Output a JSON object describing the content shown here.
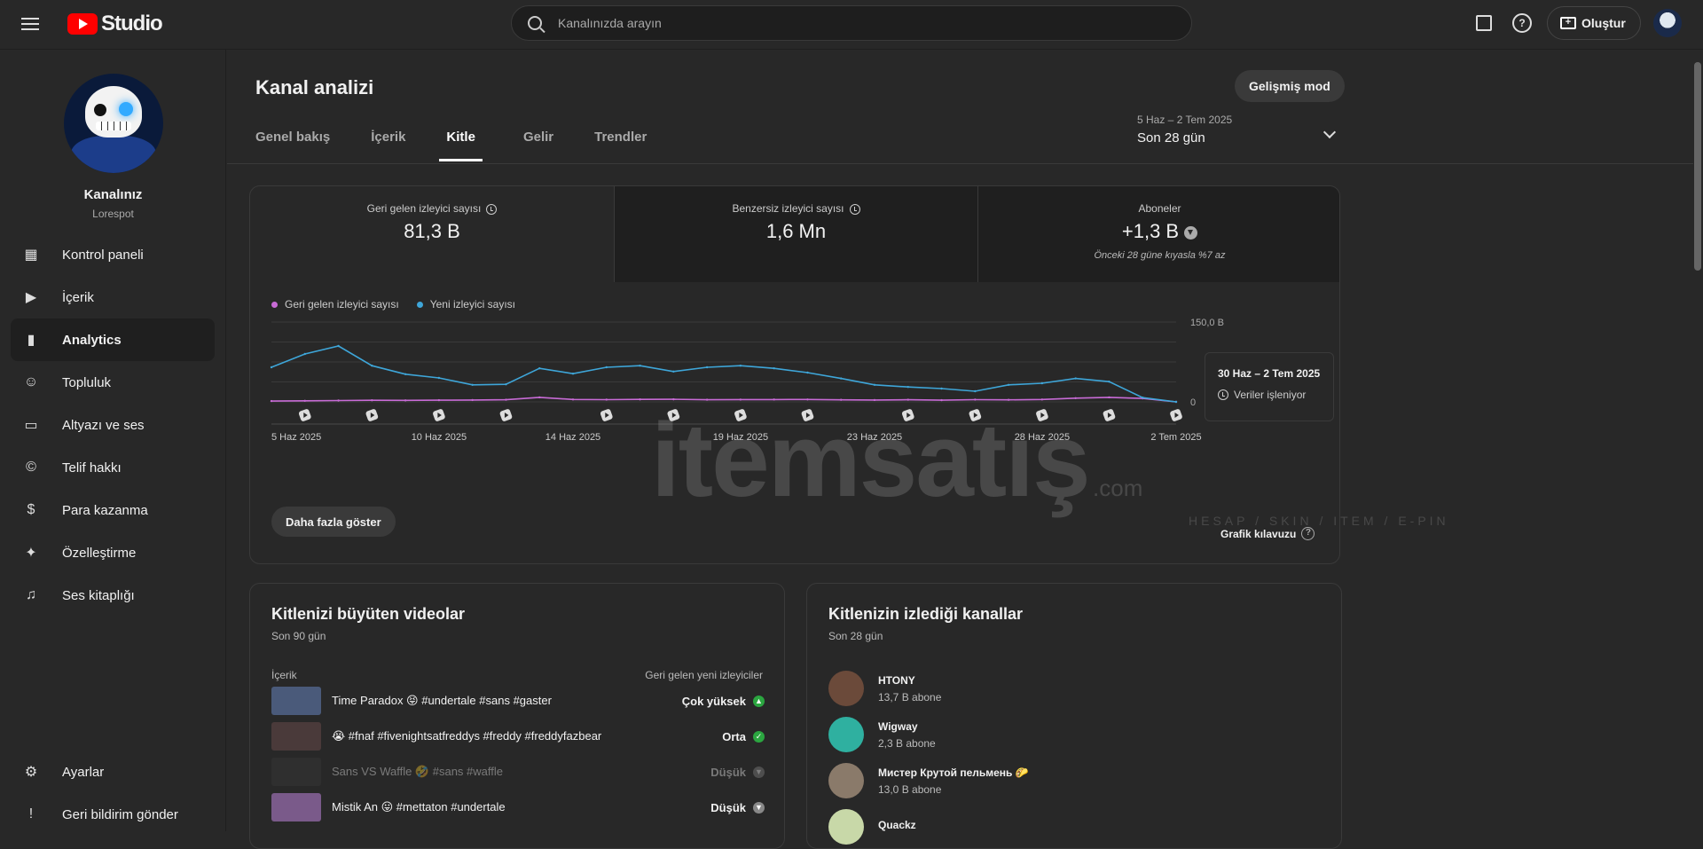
{
  "header": {
    "logo_text": "Studio",
    "search_placeholder": "Kanalınızda arayın",
    "create_label": "Oluştur"
  },
  "sidebar": {
    "channel_name": "Kanalınız",
    "channel_handle": "Lorespot",
    "items": [
      {
        "label": "Kontrol paneli",
        "icon": "dashboard-icon"
      },
      {
        "label": "İçerik",
        "icon": "content-icon"
      },
      {
        "label": "Analytics",
        "icon": "analytics-icon",
        "active": true
      },
      {
        "label": "Topluluk",
        "icon": "community-icon"
      },
      {
        "label": "Altyazı ve ses",
        "icon": "subtitles-icon"
      },
      {
        "label": "Telif hakkı",
        "icon": "copyright-icon"
      },
      {
        "label": "Para kazanma",
        "icon": "dollar-icon"
      },
      {
        "label": "Özelleştirme",
        "icon": "magic-wand-icon"
      },
      {
        "label": "Ses kitaplığı",
        "icon": "audio-library-icon"
      }
    ],
    "bottom": [
      {
        "label": "Ayarlar",
        "icon": "gear-icon"
      },
      {
        "label": "Geri bildirim gönder",
        "icon": "feedback-icon"
      }
    ]
  },
  "main": {
    "title": "Kanal analizi",
    "advanced_mode": "Gelişmiş mod",
    "tabs": [
      "Genel bakış",
      "İçerik",
      "Kitle",
      "Gelir",
      "Trendler"
    ],
    "active_tab": "Kitle",
    "date_range": "5 Haz – 2 Tem 2025",
    "date_preset": "Son 28 gün"
  },
  "kpis": [
    {
      "label": "Geri gelen izleyici sayısı",
      "value": "81,3 B"
    },
    {
      "label": "Benzersiz izleyici sayısı",
      "value": "1,6 Mn"
    },
    {
      "label": "Aboneler",
      "value": "+1,3 B",
      "note": "Önceki 28 güne kıyasla %7 az"
    }
  ],
  "chart_data": {
    "type": "line",
    "x": [
      "5 Haz 2025",
      "6 Haz",
      "7 Haz",
      "8 Haz",
      "9 Haz",
      "10 Haz 2025",
      "11 Haz",
      "12 Haz",
      "13 Haz",
      "14 Haz 2025",
      "15 Haz",
      "16 Haz",
      "17 Haz",
      "18 Haz",
      "19 Haz 2025",
      "20 Haz",
      "21 Haz",
      "22 Haz",
      "23 Haz 2025",
      "24 Haz",
      "25 Haz",
      "26 Haz",
      "27 Haz",
      "28 Haz 2025",
      "29 Haz",
      "30 Haz",
      "1 Tem",
      "2 Tem 2025"
    ],
    "tick_labels": [
      "5 Haz 2025",
      "10 Haz 2025",
      "14 Haz 2025",
      "19 Haz 2025",
      "23 Haz 2025",
      "28 Haz 2025",
      "2 Tem 2025"
    ],
    "tick_indices": [
      0,
      5,
      9,
      14,
      18,
      23,
      27
    ],
    "y_ticks": [
      "150,0 B",
      "0"
    ],
    "ylim": [
      0,
      150000
    ],
    "series": [
      {
        "name": "Geri gelen izleyici sayısı",
        "color": "#c86bd6",
        "values": [
          1500,
          2000,
          2500,
          3000,
          2800,
          3200,
          3500,
          4000,
          8500,
          4500,
          4200,
          4600,
          4800,
          4000,
          4300,
          4400,
          4500,
          3800,
          3500,
          4000,
          3200,
          4200,
          3800,
          4500,
          7000,
          8500,
          6500,
          0
        ]
      },
      {
        "name": "Yeni izleyici sayısı",
        "color": "#3ea6d9",
        "values": [
          65000,
          90000,
          105000,
          68000,
          52000,
          45000,
          32000,
          33000,
          63000,
          53000,
          65000,
          68000,
          57000,
          65000,
          68000,
          63000,
          55000,
          44000,
          32000,
          28000,
          25000,
          20000,
          32000,
          35000,
          44000,
          38000,
          8000,
          0
        ]
      }
    ],
    "shorts_markers": [
      1,
      3,
      5,
      7,
      10,
      12,
      14,
      16,
      19,
      21,
      23,
      25,
      27
    ],
    "tooltip": {
      "title": "30 Haz – 2 Tem 2025",
      "sub": "Veriler işleniyor"
    }
  },
  "chart": {
    "show_more": "Daha fazla göster",
    "guide": "Grafik kılavuzu"
  },
  "videos_card": {
    "title": "Kitlenizi büyüten videolar",
    "subtitle": "Son 90 gün",
    "col_left": "İçerik",
    "col_right": "Geri gelen yeni izleyiciler",
    "rows": [
      {
        "title": "Time Paradox 😝 #undertale #sans #gaster",
        "level": "Çok yüksek",
        "status_color": "#2ba640"
      },
      {
        "title": "😭 #fnaf #fivenightsatfreddys #freddy #freddyfazbear",
        "level": "Orta",
        "status_color": "#2ba640"
      },
      {
        "title": "Sans VS Waffle 🤣 #sans #waffle",
        "level": "Düşük",
        "status_color": "#888888",
        "dim": true
      },
      {
        "title": "Mistik An 😛 #mettaton #undertale",
        "level": "Düşük",
        "status_color": "#888888"
      }
    ]
  },
  "channels_card": {
    "title": "Kitlenizin izlediği kanallar",
    "subtitle": "Son 28 gün",
    "rows": [
      {
        "name": "HTONY",
        "subs": "13,7 B abone"
      },
      {
        "name": "Wigway",
        "subs": "2,3 B abone"
      },
      {
        "name": "Мистер Крутой пельмень 🌮",
        "subs": "13,0 B abone"
      },
      {
        "name": "Quackz",
        "subs": ""
      }
    ]
  },
  "watermark": {
    "text": "itemsatış",
    "sub": "HESAP / SKIN / ITEM / E-PIN",
    "suffix": ".com"
  }
}
